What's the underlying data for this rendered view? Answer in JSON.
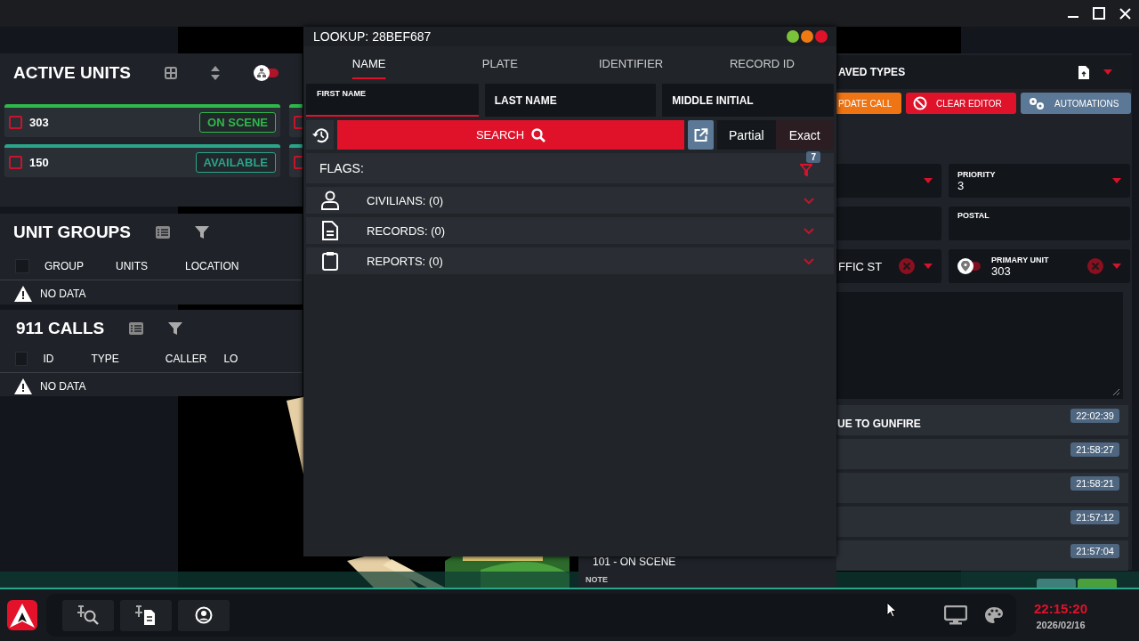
{
  "active_units": {
    "title": "ACTIVE UNITS",
    "grouping_on": false,
    "units": [
      {
        "callsign": "303",
        "status": "ON SCENE",
        "color": "#2fb84a",
        "checked": false
      },
      {
        "color": "#2fb84a",
        "checked": false
      },
      {
        "callsign": "150",
        "status": "AVAILABLE",
        "color": "#2aa58a",
        "checked": false
      },
      {
        "color": "#2aa58a",
        "checked": false
      }
    ]
  },
  "unit_groups": {
    "title": "UNIT GROUPS",
    "all_checked": false,
    "columns": [
      "GROUP",
      "UNITS",
      "LOCATION"
    ],
    "empty_text": "NO DATA"
  },
  "calls_911": {
    "title": "911 CALLS",
    "all_checked": false,
    "columns": [
      "ID",
      "TYPE",
      "CALLER",
      "LO"
    ],
    "empty_text": "NO DATA"
  },
  "lookup": {
    "title": "LOOKUP: 28BEF687",
    "tabs": [
      {
        "label": "NAME",
        "selected": true
      },
      {
        "label": "PLATE",
        "selected": false
      },
      {
        "label": "IDENTIFIER",
        "selected": false
      },
      {
        "label": "RECORD ID",
        "selected": false
      }
    ],
    "fields": [
      {
        "label": "FIRST NAME",
        "focused": true
      },
      {
        "label": "LAST NAME",
        "focused": false
      },
      {
        "label": "MIDDLE INITIAL",
        "focused": false
      }
    ],
    "search_button": "SEARCH",
    "match_modes": [
      {
        "label": "Partial",
        "selected": false
      },
      {
        "label": "Exact",
        "selected": true
      }
    ],
    "flags_label": "FLAGS:",
    "filter_count": "7",
    "sections": [
      {
        "label": "CIVILIANS: (0)",
        "kind": "person",
        "expanded": false
      },
      {
        "label": "RECORDS: (0)",
        "kind": "document",
        "expanded": false
      },
      {
        "label": "REPORTS: (0)",
        "kind": "clipboard",
        "expanded": false
      }
    ]
  },
  "call_editor": {
    "saved_types": "AVED TYPES",
    "buttons": [
      {
        "label": "PDATE CALL",
        "kind": "update"
      },
      {
        "label": "CLEAR EDITOR",
        "kind": "clear"
      },
      {
        "label": "AUTOMATIONS",
        "kind": "automations"
      }
    ],
    "priority": {
      "label": "PRIORITY",
      "value": "3"
    },
    "postal": {
      "label": "POSTAL"
    },
    "call_type": {
      "value": "FFIC ST"
    },
    "primary_unit": {
      "label": "PRIMARY UNIT",
      "value": "303",
      "tracking_on": false
    },
    "log": [
      {
        "text": "UE TO GUNFIRE",
        "time": "22:02:39"
      },
      {
        "time": "21:58:27"
      },
      {
        "time": "21:58:21"
      },
      {
        "time": "21:57:12"
      },
      {
        "time": "21:57:04"
      }
    ]
  },
  "background_log": {
    "entry": "101 - ON SCENE",
    "note_label": "NOTE"
  },
  "taskbar": {
    "clock": "22:15:20",
    "date": "2026/02/16"
  }
}
